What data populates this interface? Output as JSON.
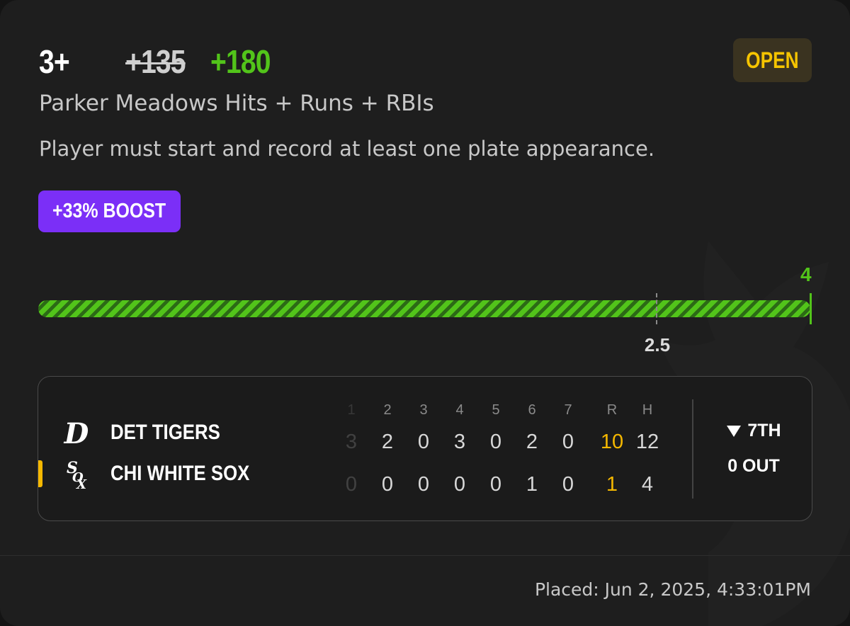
{
  "bet": {
    "line": "3+",
    "original_odds": "+135",
    "boosted_odds": "+180",
    "status": "OPEN",
    "market": "Parker Meadows Hits + Runs + RBIs",
    "rule": "Player must start and record at least one plate appearance.",
    "boost_label": "+33% BOOST"
  },
  "progress": {
    "current": 4,
    "current_label": "4",
    "line": 2.5,
    "line_label": "2.5",
    "fill_fraction": 1.0
  },
  "scoreboard": {
    "headers": [
      "1",
      "2",
      "3",
      "4",
      "5",
      "6",
      "7",
      "R",
      "H"
    ],
    "teams": [
      {
        "name": "DET TIGERS",
        "logo": "tigers-d-logo",
        "innings": [
          "3",
          "2",
          "0",
          "3",
          "0",
          "2",
          "0"
        ],
        "runs": "10",
        "hits": "12"
      },
      {
        "name": "CHI WHITE SOX",
        "logo": "white-sox-logo",
        "innings": [
          "0",
          "0",
          "0",
          "0",
          "0",
          "1",
          "0"
        ],
        "runs": "1",
        "hits": "4"
      }
    ],
    "inning": "7TH",
    "inning_half_icon": "triangle-down-icon",
    "outs": "0 OUT"
  },
  "placed": "Placed: Jun 2, 2025, 4:33:01PM",
  "colors": {
    "accent_green": "#52c41a",
    "status_yellow": "#f5c400",
    "boost_purple": "#7b2ff7",
    "runs_gold": "#f5b800"
  }
}
